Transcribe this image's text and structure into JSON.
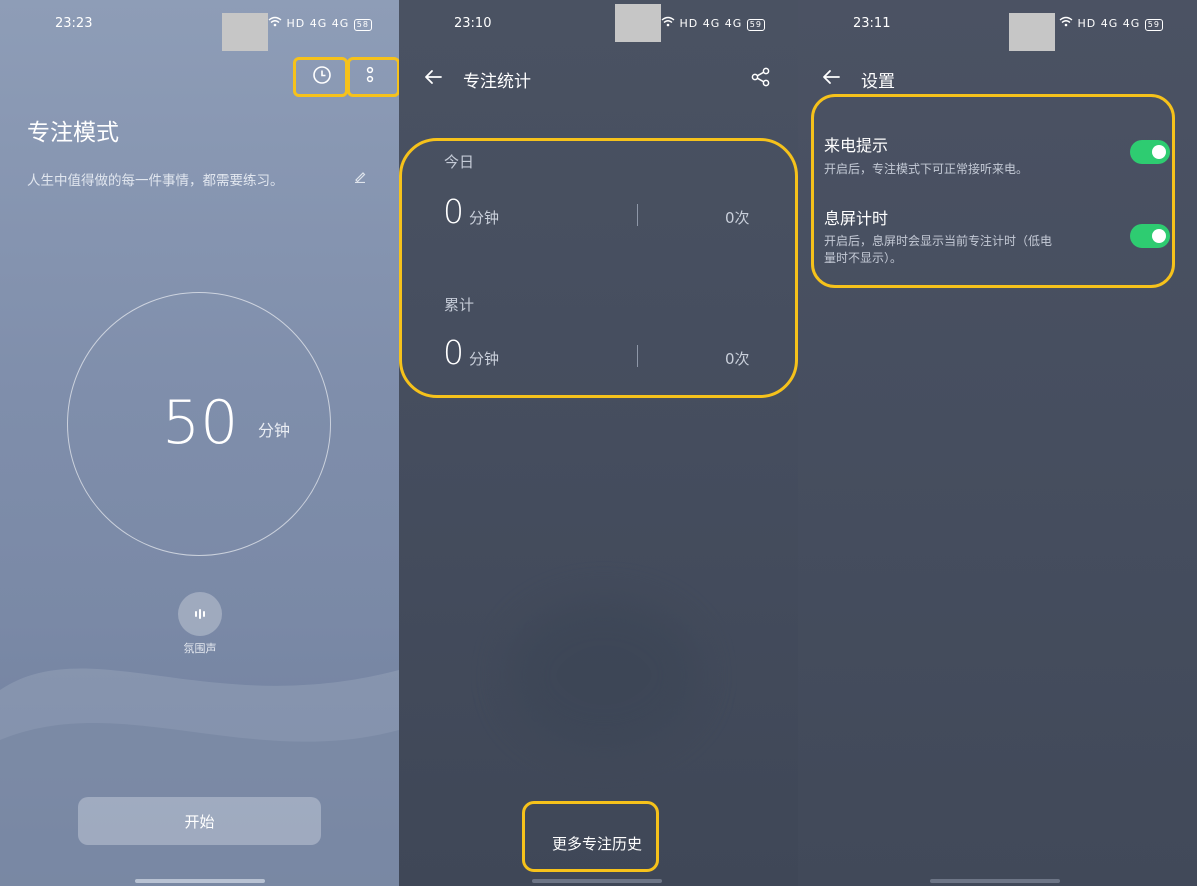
{
  "colors": {
    "highlight": "#f6c21b",
    "toggle_on": "#2ecc71"
  },
  "focus_screen": {
    "status": {
      "time": "23:23",
      "network": "HD 4G 4G",
      "battery": "58"
    },
    "title": "专注模式",
    "motto": "人生中值得做的每一件事情，都需要练习。",
    "timer_value": "50",
    "timer_unit": "分钟",
    "ambient_label": "氛围声",
    "start_label": "开始",
    "icons": [
      "clock-icon",
      "more-icon",
      "edit-icon",
      "sound-wave-icon"
    ]
  },
  "stats_screen": {
    "status": {
      "time": "23:10",
      "network": "HD 4G 4G",
      "battery": "59"
    },
    "title": "专注统计",
    "today": {
      "label": "今日",
      "minutes": "0",
      "minutes_unit": "分钟",
      "count": "0次"
    },
    "total": {
      "label": "累计",
      "minutes": "0",
      "minutes_unit": "分钟",
      "count": "0次"
    },
    "more_history_label": "更多专注历史",
    "icons": [
      "back-arrow-icon",
      "share-icon"
    ]
  },
  "settings_screen": {
    "status": {
      "time": "23:11",
      "network": "HD 4G 4G",
      "battery": "59"
    },
    "title": "设置",
    "items": [
      {
        "title": "来电提示",
        "desc": "开启后，专注模式下可正常接听来电。",
        "enabled": true
      },
      {
        "title": "息屏计时",
        "desc": "开启后，息屏时会显示当前专注计时（低电",
        "desc2": "量时不显示）。",
        "enabled": true
      }
    ],
    "icons": [
      "back-arrow-icon"
    ]
  }
}
